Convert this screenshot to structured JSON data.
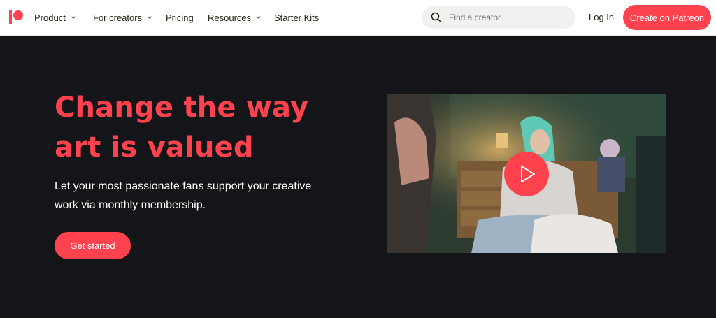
{
  "nav": {
    "logo_icon": "patreon-logo-icon",
    "items": [
      {
        "label": "Product",
        "has_dropdown": true
      },
      {
        "label": "For creators",
        "has_dropdown": true
      },
      {
        "label": "Pricing",
        "has_dropdown": false
      },
      {
        "label": "Resources",
        "has_dropdown": true
      },
      {
        "label": "Starter Kits",
        "has_dropdown": false
      }
    ],
    "search": {
      "placeholder": "Find a creator",
      "value": "",
      "icon": "search-icon"
    },
    "login_label": "Log In",
    "cta_label": "Create on Patreon"
  },
  "hero": {
    "headline_line1": "Change the way",
    "headline_line2": "art is valued",
    "subtitle_line1": "Let your most passionate fans support your creative",
    "subtitle_line2": "work via monthly membership.",
    "cta_label": "Get started",
    "video": {
      "play_icon": "play-icon"
    }
  },
  "colors": {
    "accent": "#ff424d",
    "hero_background": "#141518",
    "nav_background": "#ffffff",
    "text_dark": "#241e12",
    "search_background": "#f1f1ef"
  }
}
